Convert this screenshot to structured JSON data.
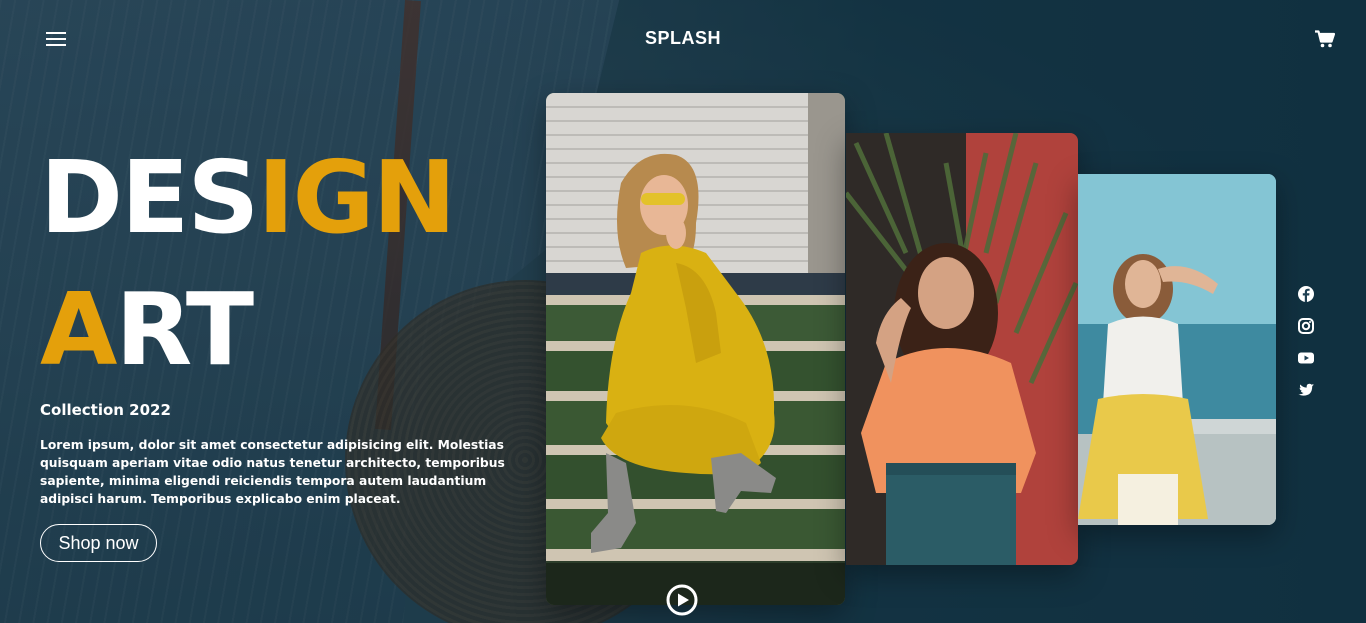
{
  "header": {
    "brand": "SPLASH",
    "menu_icon": "hamburger-menu-icon",
    "cart_icon": "shopping-cart-icon"
  },
  "hero": {
    "headline_line1_white": "DES",
    "headline_line1_accent": "IGN",
    "headline_line2_accent": "A",
    "headline_line2_white": "RT",
    "collection": "Collection 2022",
    "description": "Lorem ipsum, dolor sit amet consectetur adipisicing elit. Molestias quisquam aperiam vitae odio natus tenetur architecto, temporibus sapiente, minima eligendi reiciendis tempora autem laudantium adipisci harum. Temporibus explicabo enim placeat.",
    "cta_label": "Shop now"
  },
  "gallery": {
    "play_icon": "play-circle-icon"
  },
  "social": [
    "facebook-icon",
    "instagram-icon",
    "youtube-icon",
    "twitter-icon"
  ],
  "colors": {
    "accent": "#e4a00b",
    "background": "#163849",
    "text": "#ffffff"
  }
}
